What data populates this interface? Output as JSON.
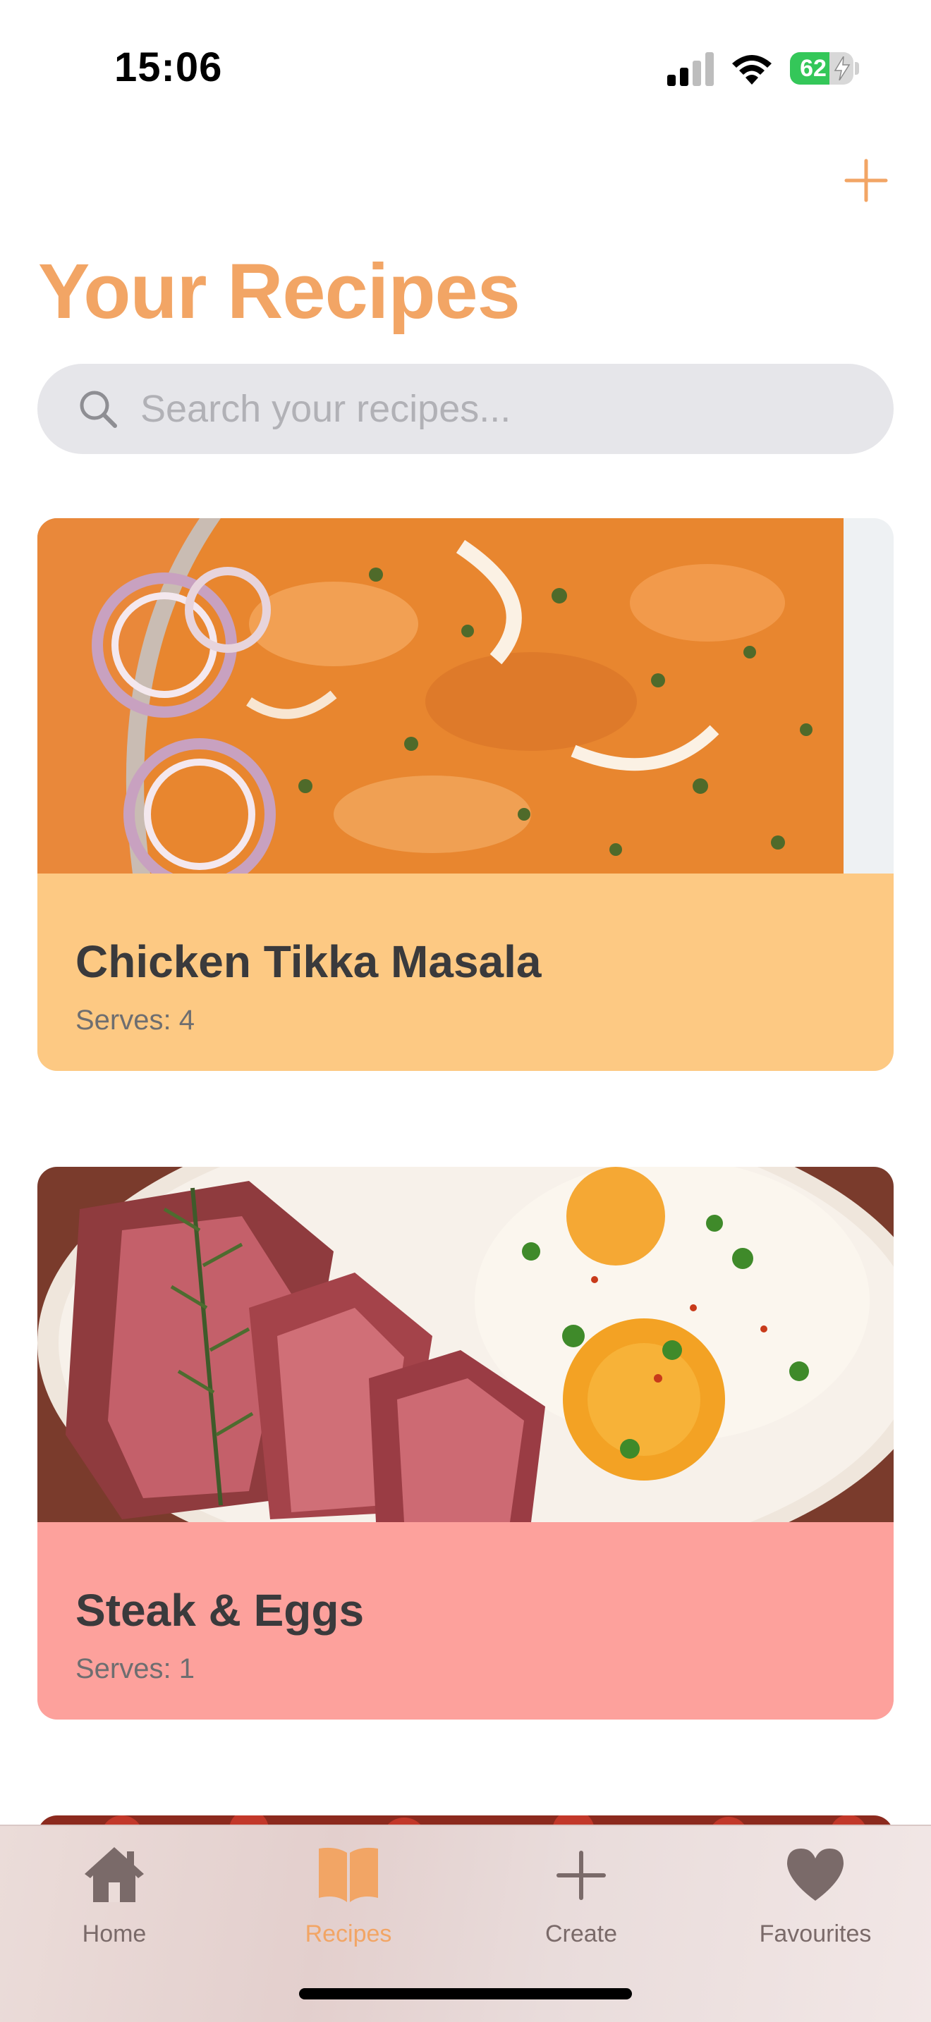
{
  "status_bar": {
    "time": "15:06",
    "battery_percent": "62",
    "battery_level": 0.62,
    "icons": [
      "signal-icon",
      "wifi-icon",
      "battery-icon"
    ]
  },
  "header": {
    "title": "Your Recipes",
    "add_icon": "plus-icon"
  },
  "search": {
    "placeholder": "Search your recipes...",
    "value": "",
    "icon": "search-icon"
  },
  "recipes": [
    {
      "title": "Chicken Tikka Masala",
      "serves": "Serves: 4",
      "footer_color": "#fdc983"
    },
    {
      "title": "Steak & Eggs",
      "serves": "Serves: 1",
      "footer_color": "#fda19c"
    }
  ],
  "tab_bar": {
    "tabs": [
      {
        "label": "Home",
        "icon": "house-icon",
        "active": false
      },
      {
        "label": "Recipes",
        "icon": "book-icon",
        "active": true
      },
      {
        "label": "Create",
        "icon": "plus-icon",
        "active": false
      },
      {
        "label": "Favourites",
        "icon": "heart-icon",
        "active": false
      }
    ]
  },
  "colors": {
    "accent": "#f2a565",
    "tab_inactive": "#7a6a69"
  }
}
